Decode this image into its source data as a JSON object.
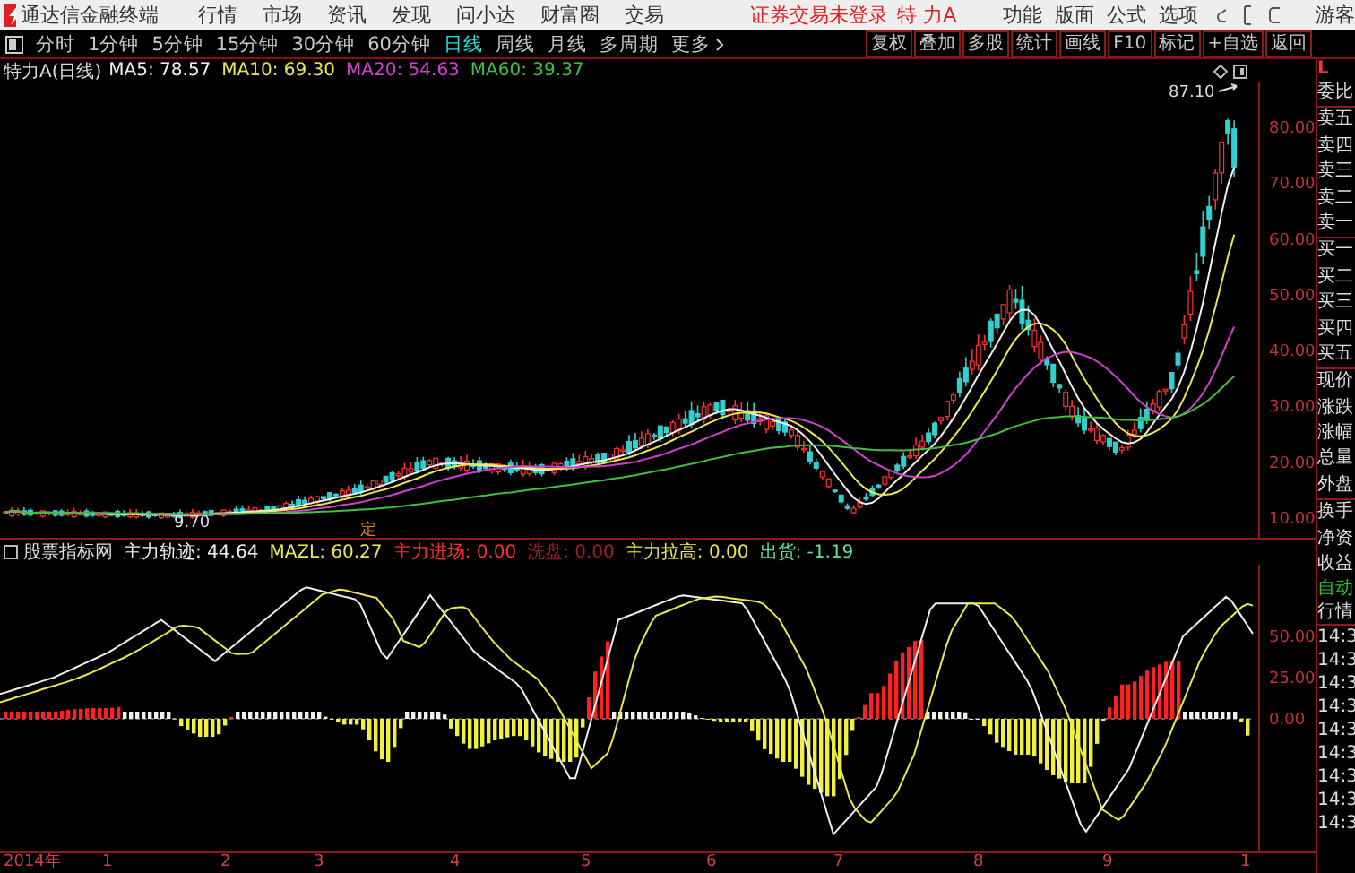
{
  "menubar": {
    "app_title": "通达信金融终端",
    "menus": [
      "行情",
      "市场",
      "资讯",
      "发现",
      "问小达",
      "财富圈",
      "交易"
    ],
    "login_status": "证券交易未登录",
    "stock_name": "特 力A",
    "tools": [
      "功能",
      "版面",
      "公式",
      "选项"
    ],
    "user": "游客"
  },
  "periods": [
    {
      "label": "分时",
      "selected": false
    },
    {
      "label": "1分钟",
      "selected": false
    },
    {
      "label": "5分钟",
      "selected": false
    },
    {
      "label": "15分钟",
      "selected": false
    },
    {
      "label": "30分钟",
      "selected": false
    },
    {
      "label": "60分钟",
      "selected": false
    },
    {
      "label": "日线",
      "selected": true
    },
    {
      "label": "周线",
      "selected": false
    },
    {
      "label": "月线",
      "selected": false
    },
    {
      "label": "多周期",
      "selected": false
    },
    {
      "label": "更多",
      "selected": false
    }
  ],
  "chart_buttons": [
    "复权",
    "叠加",
    "多股",
    "统计",
    "画线",
    "F10",
    "标记",
    "+自选",
    "返回"
  ],
  "price_header": {
    "title": "特力A(日线)",
    "ma": [
      {
        "label": "MA5: 78.57",
        "color": "#f0f0f0"
      },
      {
        "label": "MA10: 69.30",
        "color": "#e8e850"
      },
      {
        "label": "MA20: 54.63",
        "color": "#d040d0"
      },
      {
        "label": "MA60: 39.37",
        "color": "#40c040"
      }
    ]
  },
  "price_axis": [
    "80.00",
    "70.00",
    "60.00",
    "50.00",
    "40.00",
    "30.00",
    "20.00",
    "10.00"
  ],
  "high_marker": "87.10",
  "low_marker": "9.70",
  "event_marker": "定",
  "indicator": {
    "name": "股票指标网",
    "values": [
      {
        "label": "主力轨迹: 44.64",
        "color": "#f0f0f0"
      },
      {
        "label": "MAZL: 60.27",
        "color": "#e8e850"
      },
      {
        "label": "主力进场: 0.00",
        "color": "#ff3030"
      },
      {
        "label": "洗盘: 0.00",
        "color": "#a02020"
      },
      {
        "label": "主力拉高: 0.00",
        "color": "#e8e850"
      },
      {
        "label": "出货: -1.19",
        "color": "#60e0a0"
      }
    ]
  },
  "indicator_axis": [
    "50.00",
    "25.00",
    "0.00"
  ],
  "time_axis": [
    "2014年",
    "1",
    "2",
    "3",
    "4",
    "5",
    "6",
    "7",
    "8",
    "9",
    "1"
  ],
  "side_panel": {
    "header": "L",
    "labels": [
      "委比",
      "卖五",
      "卖四",
      "卖三",
      "卖二",
      "卖一",
      "买一",
      "买二",
      "买三",
      "买四",
      "买五",
      "现价",
      "涨跌",
      "涨幅",
      "总量",
      "外盘",
      "换手",
      "净资",
      "收益"
    ],
    "auto": "自动",
    "quote": "行情",
    "times": [
      "14:3",
      "14:3",
      "14:3",
      "14:3",
      "14:3",
      "14:3",
      "14:3",
      "14:3",
      "14:3"
    ]
  }
}
